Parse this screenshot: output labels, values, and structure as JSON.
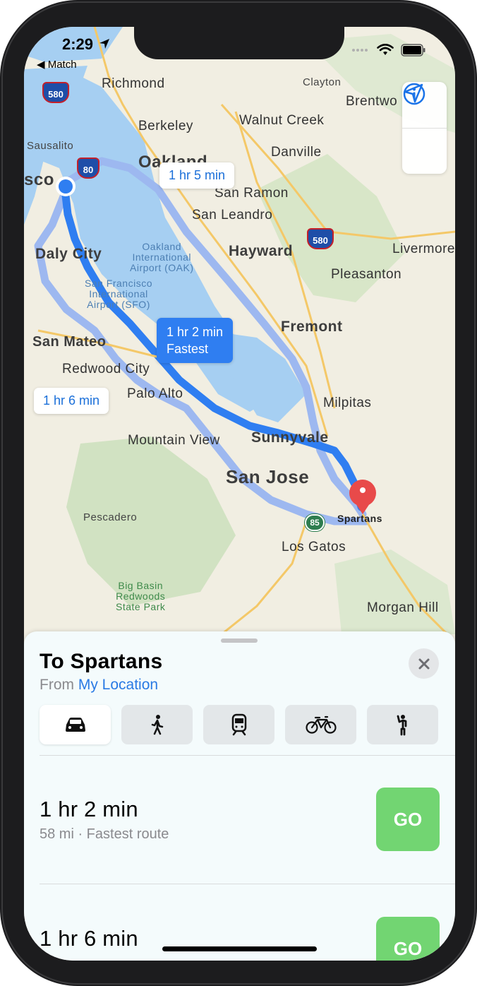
{
  "status_bar": {
    "time": "2:29",
    "back_label": "Match"
  },
  "map": {
    "places": {
      "richmond": "Richmond",
      "clayton": "Clayton",
      "brentwood": "Brentwo",
      "berkeley": "Berkeley",
      "walnut_creek": "Walnut Creek",
      "sausalito": "Sausalito",
      "oakland": "Oakland",
      "danville": "Danville",
      "sf": "sco",
      "san_ramon": "San Ramon",
      "san_leandro": "San Leandro",
      "daly_city": "Daly City",
      "hayward": "Hayward",
      "livermore": "Livermore",
      "pleasanton": "Pleasanton",
      "oak_airport": "Oakland\nInternational\nAirport (OAK)",
      "sfo_airport": "San Francisco\nInternational\nAirport (SFO)",
      "fremont": "Fremont",
      "san_mateo": "San Mateo",
      "redwood_city": "Redwood City",
      "palo_alto": "Palo Alto",
      "milpitas": "Milpitas",
      "mountain_view": "Mountain View",
      "sunnyvale": "Sunnyvale",
      "san_jose": "San Jose",
      "pescadero": "Pescadero",
      "los_gatos": "Los Gatos",
      "big_basin": "Big Basin\nRedwoods\nState Park",
      "morgan_hill": "Morgan Hill",
      "destination": "Spartans"
    },
    "shields": {
      "i580_north": "580",
      "i80": "80",
      "i580_east": "580",
      "sr85": "85"
    },
    "callouts": {
      "route_a": "1 hr 5 min",
      "route_fast_time": "1 hr 2 min",
      "route_fast_label": "Fastest",
      "route_c": "1 hr 6 min"
    }
  },
  "sheet": {
    "title": "To Spartans",
    "from_prefix": "From",
    "from_link": "My Location",
    "modes": [
      "car-icon",
      "walking-icon",
      "transit-icon",
      "cycling-icon",
      "ride-share-icon"
    ],
    "routes": [
      {
        "time": "1 hr 2 min",
        "detail": "58 mi · Fastest route",
        "go": "GO"
      },
      {
        "time": "1 hr 6 min",
        "detail": "",
        "go": "GO"
      }
    ]
  },
  "colors": {
    "route_primary": "#2f7ef1",
    "route_alternate": "#9db8f0",
    "go_button": "#72d572",
    "destination_pin": "#e84a4a"
  }
}
